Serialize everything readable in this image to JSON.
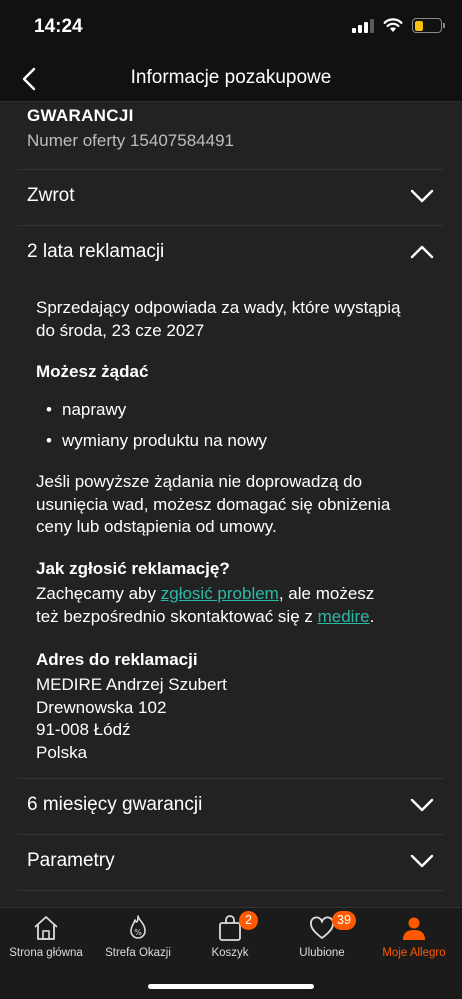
{
  "status_bar": {
    "time": "14:24",
    "battery_level": 0.35,
    "battery_color": "#f4c20d"
  },
  "nav": {
    "title": "Informacje pozakupowe",
    "back_icon": "chevron-left-icon"
  },
  "warranty_header": {
    "heading": "GWARANCJI",
    "offer_number": "Numer oferty 15407584491"
  },
  "sections": {
    "zwrot": {
      "title": "Zwrot",
      "expanded": false
    },
    "reklamacja": {
      "title": "2 lata reklamacji",
      "expanded": true
    },
    "gwarancja": {
      "title": "6 miesięcy gwarancji",
      "expanded": false
    },
    "parametry": {
      "title": "Parametry",
      "expanded": false
    }
  },
  "complaint": {
    "liability_line1": "Sprzedający odpowiada za wady, które wystąpią",
    "liability_line2": "do środa, 23 cze 2027",
    "demands_heading": "Możesz żądać",
    "demands": [
      "naprawy",
      "wymiany produktu na nowy"
    ],
    "fallback_line1": "Jeśli powyższe żądania nie doprowadzą do",
    "fallback_line2": "usunięcia wad, możesz domagać się obniżenia",
    "fallback_line3": "ceny lub odstąpienia od umowy.",
    "howto_heading": "Jak zgłosić reklamację?",
    "howto_prefix": "Zachęcamy aby ",
    "howto_link": "zgłosić problem",
    "howto_middle": ", ale możesz",
    "howto_line2_prefix": "też bezpośrednio skontaktować się z ",
    "howto_seller_link": "medire",
    "howto_suffix": ".",
    "address_heading": "Adres do reklamacji",
    "address_lines": [
      "MEDIRE Andrzej Szubert",
      "Drewnowska 102",
      "91-008 Łódź",
      "Polska"
    ]
  },
  "tabs": [
    {
      "label": "Strona główna",
      "icon": "home-icon"
    },
    {
      "label": "Strefa Okazji",
      "icon": "deals-icon"
    },
    {
      "label": "Koszyk",
      "icon": "cart-icon",
      "badge": "2"
    },
    {
      "label": "Ulubione",
      "icon": "heart-icon",
      "badge": "39"
    },
    {
      "label": "Moje Allegro",
      "icon": "user-icon",
      "active": true
    }
  ],
  "colors": {
    "accent": "#ff5a00",
    "link": "#2bb9a6",
    "background": "#222222"
  }
}
